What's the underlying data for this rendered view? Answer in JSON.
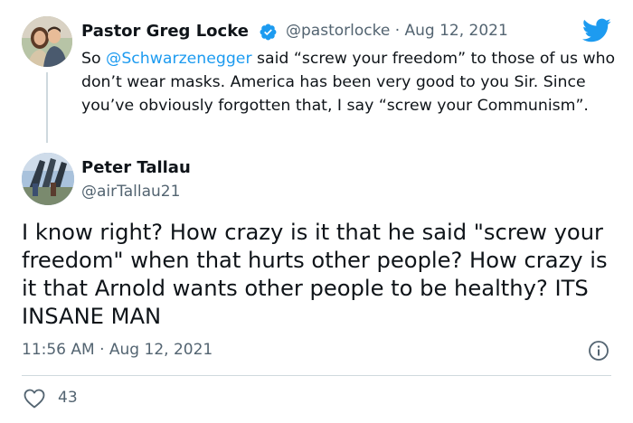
{
  "reply_to": {
    "author_name": "Pastor Greg Locke",
    "handle": "@pastorlocke",
    "separator": "·",
    "date": "Aug 12, 2021",
    "text_prefix": "So ",
    "mention": "@Schwarzenegger",
    "text_rest": " said “screw your freedom” to those of us who don’t wear masks. America has been very good to you Sir. Since you’ve obviously forgotten that, I say “screw your Communism”.",
    "verified_icon": "verified-badge-icon",
    "avatar_icon": "avatar"
  },
  "tweet": {
    "author_name": "Peter Tallau",
    "handle": "@airTallau21",
    "text": "I know right? How crazy is it that he said \"screw your freedom\" when that hurts other people? How crazy is it that Arnold wants other people to be healthy? ITS INSANE MAN",
    "timestamp": "11:56 AM · Aug 12, 2021",
    "like_count": "43"
  },
  "icons": {
    "brand": "twitter-bird-icon",
    "info": "info-icon",
    "like": "heart-icon"
  },
  "colors": {
    "accent": "#1d9bf0",
    "text": "#0f1419",
    "secondary": "#536471",
    "divider": "#cfd9de"
  }
}
